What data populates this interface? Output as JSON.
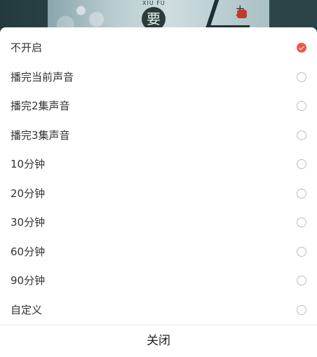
{
  "cover_art": {
    "pinyin_text": "XIU FU",
    "circle_char": "要",
    "corner_char": "九"
  },
  "sleep_timer": {
    "options": [
      {
        "label": "不开启",
        "selected": true
      },
      {
        "label": "播完当前声音",
        "selected": false
      },
      {
        "label": "播完2集声音",
        "selected": false
      },
      {
        "label": "播完3集声音",
        "selected": false
      },
      {
        "label": "10分钟",
        "selected": false
      },
      {
        "label": "20分钟",
        "selected": false
      },
      {
        "label": "30分钟",
        "selected": false
      },
      {
        "label": "60分钟",
        "selected": false
      },
      {
        "label": "90分钟",
        "selected": false
      },
      {
        "label": "自定义",
        "selected": false
      }
    ],
    "close_label": "关闭"
  },
  "colors": {
    "accent": "#f0574a",
    "radio_border": "#bdbdbd",
    "text": "#333333"
  },
  "icons": {
    "selected": "check-circle-icon",
    "unselected": "radio-empty-icon"
  }
}
